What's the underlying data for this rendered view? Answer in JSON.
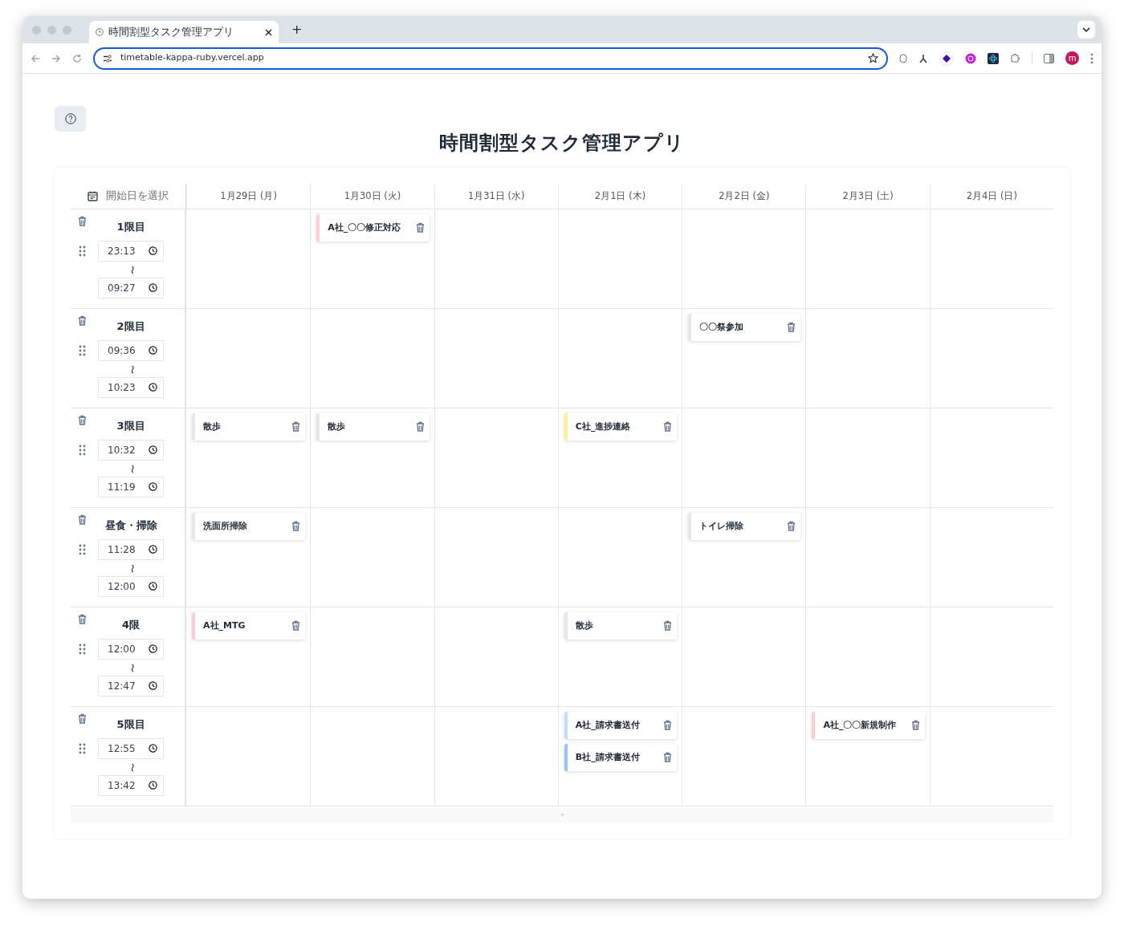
{
  "browser": {
    "tab_title": "時間割型タスク管理アプリ",
    "new_tab": "+",
    "url": "timetable-kappa-ruby.vercel.app",
    "profile_initial": "m"
  },
  "app": {
    "title": "時間割型タスク管理アプリ",
    "start_date_label": "開始日を選択",
    "days": [
      "1月29日 (月)",
      "1月30日 (火)",
      "1月31日 (水)",
      "2月1日 (木)",
      "2月2日 (金)",
      "2月3日 (土)",
      "2月4日 (日)"
    ],
    "periods": [
      {
        "name": "1限目",
        "start": "23:13",
        "separator": "〜",
        "end": "09:27",
        "cells": [
          {},
          {
            "tasks": [
              {
                "title": "A社_〇〇修正対応",
                "color": "#fecdd3"
              }
            ]
          },
          {},
          {},
          {},
          {},
          {}
        ]
      },
      {
        "name": "2限目",
        "start": "09:36",
        "separator": "〜",
        "end": "10:23",
        "cells": [
          {},
          {},
          {},
          {},
          {
            "tasks": [
              {
                "title": "〇〇祭参加",
                "color": "#e5e7eb"
              }
            ]
          },
          {},
          {}
        ]
      },
      {
        "name": "3限目",
        "start": "10:32",
        "separator": "〜",
        "end": "11:19",
        "cells": [
          {
            "tasks": [
              {
                "title": "散歩",
                "color": "#e5e7eb"
              }
            ]
          },
          {
            "tasks": [
              {
                "title": "散歩",
                "color": "#e5e7eb"
              }
            ]
          },
          {},
          {
            "tasks": [
              {
                "title": "C社_進捗連絡",
                "color": "#fef08a"
              }
            ]
          },
          {},
          {},
          {}
        ]
      },
      {
        "name": "昼食・掃除",
        "start": "11:28",
        "separator": "〜",
        "end": "12:00",
        "cells": [
          {
            "tasks": [
              {
                "title": "洗面所掃除",
                "color": "#e5e7eb"
              }
            ]
          },
          {},
          {},
          {},
          {
            "tasks": [
              {
                "title": "トイレ掃除",
                "color": "#e5e7eb"
              }
            ]
          },
          {},
          {}
        ]
      },
      {
        "name": "4限",
        "start": "12:00",
        "separator": "〜",
        "end": "12:47",
        "cells": [
          {
            "tasks": [
              {
                "title": "A社_MTG",
                "color": "#fecdd3"
              }
            ]
          },
          {},
          {},
          {
            "tasks": [
              {
                "title": "散歩",
                "color": "#e5e7eb"
              }
            ]
          },
          {},
          {},
          {}
        ]
      },
      {
        "name": "5限目",
        "start": "12:55",
        "separator": "〜",
        "end": "13:42",
        "cells": [
          {},
          {},
          {},
          {
            "tasks": [
              {
                "title": "A社_請求書送付",
                "color": "#bfdbfe"
              },
              {
                "title": "B社_請求書送付",
                "color": "#93c5fd"
              }
            ]
          },
          {},
          {
            "tasks": [
              {
                "title": "A社_〇〇新規制作",
                "color": "#fecdd3"
              }
            ]
          },
          {}
        ]
      }
    ]
  }
}
